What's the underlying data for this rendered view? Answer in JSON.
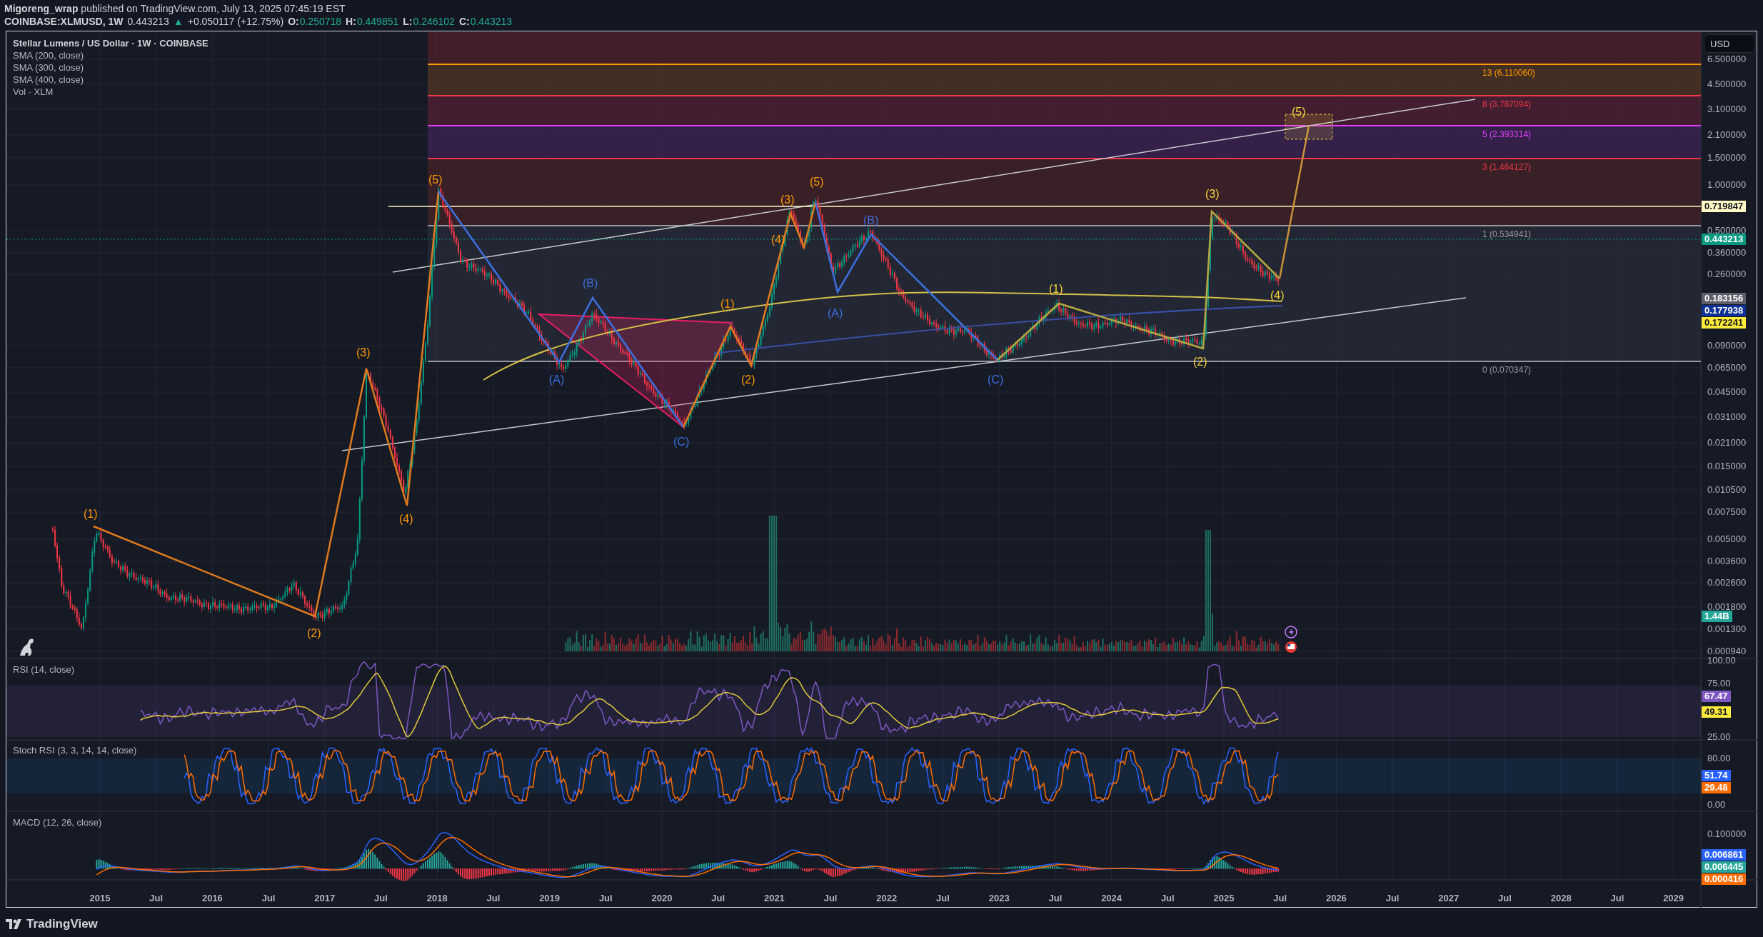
{
  "header": {
    "author": "Migoreng_wrap",
    "published": "published on TradingView.com, July 13, 2025 07:45:19 EST"
  },
  "quote": {
    "symbol": "COINBASE:XLMUSD, 1W",
    "price": "0.443213",
    "arrow": "▲",
    "change": "+0.050117 (+12.75%)",
    "ohlc": [
      {
        "label": "O:",
        "value": "0.250718"
      },
      {
        "label": "H:",
        "value": "0.449851"
      },
      {
        "label": "L:",
        "value": "0.246102"
      },
      {
        "label": "C:",
        "value": "0.443213"
      }
    ]
  },
  "legend": {
    "title": "Stellar Lumens / US Dollar · 1W · COINBASE",
    "indicators": [
      "SMA (200, close)",
      "SMA (300, close)",
      "SMA (400, close)",
      "Vol · XLM"
    ]
  },
  "currency_button": "USD",
  "price_axis": [
    "6.500000",
    "4.500000",
    "3.100000",
    "2.100000",
    "1.500000",
    "1.000000",
    "0.500000",
    "0.360000",
    "0.260000",
    "0.090000",
    "0.065000",
    "0.045000",
    "0.031000",
    "0.021000",
    "0.015000",
    "0.010500",
    "0.007500",
    "0.005000",
    "0.003600",
    "0.002600",
    "0.001800",
    "0.001300",
    "0.000940"
  ],
  "price_tags": [
    {
      "text": "0.719847",
      "color": "#fff9c4"
    },
    {
      "text": "0.443213",
      "color": "#089981"
    },
    {
      "text": "0.183156",
      "color": "#5d606b"
    },
    {
      "text": "0.177938",
      "color": "#0d3296"
    },
    {
      "text": "0.172241",
      "color": "#ffeb3b"
    },
    {
      "text": "1.44B",
      "color": "#26a69a"
    }
  ],
  "fib_levels": [
    {
      "label": "13 (6.110060)",
      "color": "#ff9800"
    },
    {
      "label": "8 (3.787094)",
      "color": "#f23645"
    },
    {
      "label": "5 (2.393314)",
      "color": "#e040fb"
    },
    {
      "label": "3 (1.464127)",
      "color": "#f23645"
    },
    {
      "label": "1 (0.534941)",
      "color": "#9598a1"
    },
    {
      "label": "0 (0.070347)",
      "color": "#9598a1"
    }
  ],
  "wave_labels": [
    {
      "text": "(1)",
      "color": "#ff9800"
    },
    {
      "text": "(2)",
      "color": "#ff9800"
    },
    {
      "text": "(3)",
      "color": "#ff9800"
    },
    {
      "text": "(4)",
      "color": "#ff9800"
    },
    {
      "text": "(5)",
      "color": "#ff9800"
    },
    {
      "text": "(A)",
      "color": "#3d6fe0"
    },
    {
      "text": "(B)",
      "color": "#3d6fe0"
    },
    {
      "text": "(C)",
      "color": "#3d6fe0"
    },
    {
      "text": "(1)",
      "color": "#ff9800"
    },
    {
      "text": "(2)",
      "color": "#ff9800"
    },
    {
      "text": "(3)",
      "color": "#ff9800"
    },
    {
      "text": "(4)",
      "color": "#ff9800"
    },
    {
      "text": "(5)",
      "color": "#ff9800"
    },
    {
      "text": "(B)",
      "color": "#3d6fe0"
    },
    {
      "text": "(A)",
      "color": "#3d6fe0"
    },
    {
      "text": "(C)",
      "color": "#3d6fe0"
    },
    {
      "text": "(1)",
      "color": "#f5d33b"
    },
    {
      "text": "(2)",
      "color": "#f5d33b"
    },
    {
      "text": "(3)",
      "color": "#f5d33b"
    },
    {
      "text": "(4)",
      "color": "#f5d33b"
    },
    {
      "text": "(5)",
      "color": "#f5d33b"
    }
  ],
  "panes": [
    {
      "title": "RSI (14, close)",
      "ticks": [
        "100.00",
        "75.00",
        "25.00"
      ],
      "tags": [
        {
          "text": "67.47",
          "color": "#7e57c2"
        },
        {
          "text": "49.31",
          "color": "#ffeb3b"
        }
      ]
    },
    {
      "title": "Stoch RSI (3, 3, 14, 14, close)",
      "ticks": [
        "80.00",
        "0.00"
      ],
      "tags": [
        {
          "text": "51.74",
          "color": "#2962ff"
        },
        {
          "text": "29.48",
          "color": "#ff6d00"
        }
      ]
    },
    {
      "title": "MACD (12, 26, close)",
      "ticks": [
        "0.100000"
      ],
      "tags": [
        {
          "text": "0.006861",
          "color": "#2962ff"
        },
        {
          "text": "0.006445",
          "color": "#26a69a"
        },
        {
          "text": "0.000416",
          "color": "#ff6d00"
        }
      ]
    }
  ],
  "time_axis": [
    "2015",
    "Jul",
    "2016",
    "Jul",
    "2017",
    "Jul",
    "2018",
    "Jul",
    "2019",
    "Jul",
    "2020",
    "Jul",
    "2021",
    "Jul",
    "2022",
    "Jul",
    "2023",
    "Jul",
    "2024",
    "Jul",
    "2025",
    "Jul",
    "2026",
    "Jul",
    "2027",
    "Jul",
    "2028",
    "Jul",
    "2029"
  ],
  "brand": "TradingView"
}
